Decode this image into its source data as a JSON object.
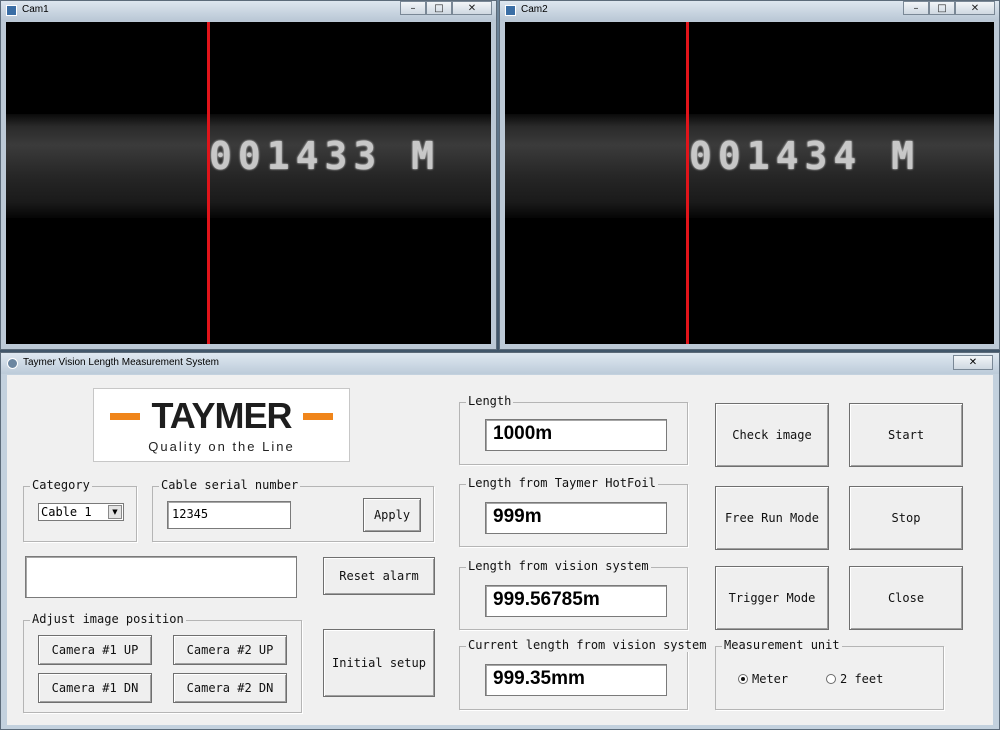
{
  "cam1": {
    "title": "Cam1",
    "overlay_text": "001433 M"
  },
  "cam2": {
    "title": "Cam2",
    "overlay_text": "001434 M"
  },
  "window_controls": {
    "minimize": "–",
    "maximize": "□",
    "close": "✕"
  },
  "main_window": {
    "title": "Taymer Vision Length Measurement System",
    "close": "✕"
  },
  "logo": {
    "brand": "TAYMER",
    "tagline": "Quality on the Line",
    "accent_color": "#f0851a"
  },
  "category": {
    "label": "Category",
    "selected": "Cable 1",
    "arrow": "▼"
  },
  "serial": {
    "label": "Cable serial number",
    "value": "12345",
    "apply": "Apply"
  },
  "alarm": {
    "value": "",
    "reset": "Reset alarm"
  },
  "adjust": {
    "label": "Adjust image position",
    "cam1_up": "Camera #1 UP",
    "cam1_dn": "Camera #1 DN",
    "cam2_up": "Camera #2 UP",
    "cam2_dn": "Camera #2 DN"
  },
  "initial_setup": "Initial setup",
  "length": {
    "label": "Length",
    "value": "1000m"
  },
  "hotfoil": {
    "label": "Length from Taymer HotFoil",
    "value": "999m"
  },
  "vision": {
    "label": "Length from vision system",
    "value": "999.56785m"
  },
  "current": {
    "label": "Current length from vision system",
    "value": "999.35mm"
  },
  "buttons": {
    "check_image": "Check image",
    "start": "Start",
    "free_run": "Free Run Mode",
    "stop": "Stop",
    "trigger": "Trigger Mode",
    "close": "Close"
  },
  "unit": {
    "label": "Measurement unit",
    "meter": "Meter",
    "feet": "2 feet",
    "selected": "Meter"
  },
  "colors": {
    "measurement_line": "#e0141a"
  }
}
